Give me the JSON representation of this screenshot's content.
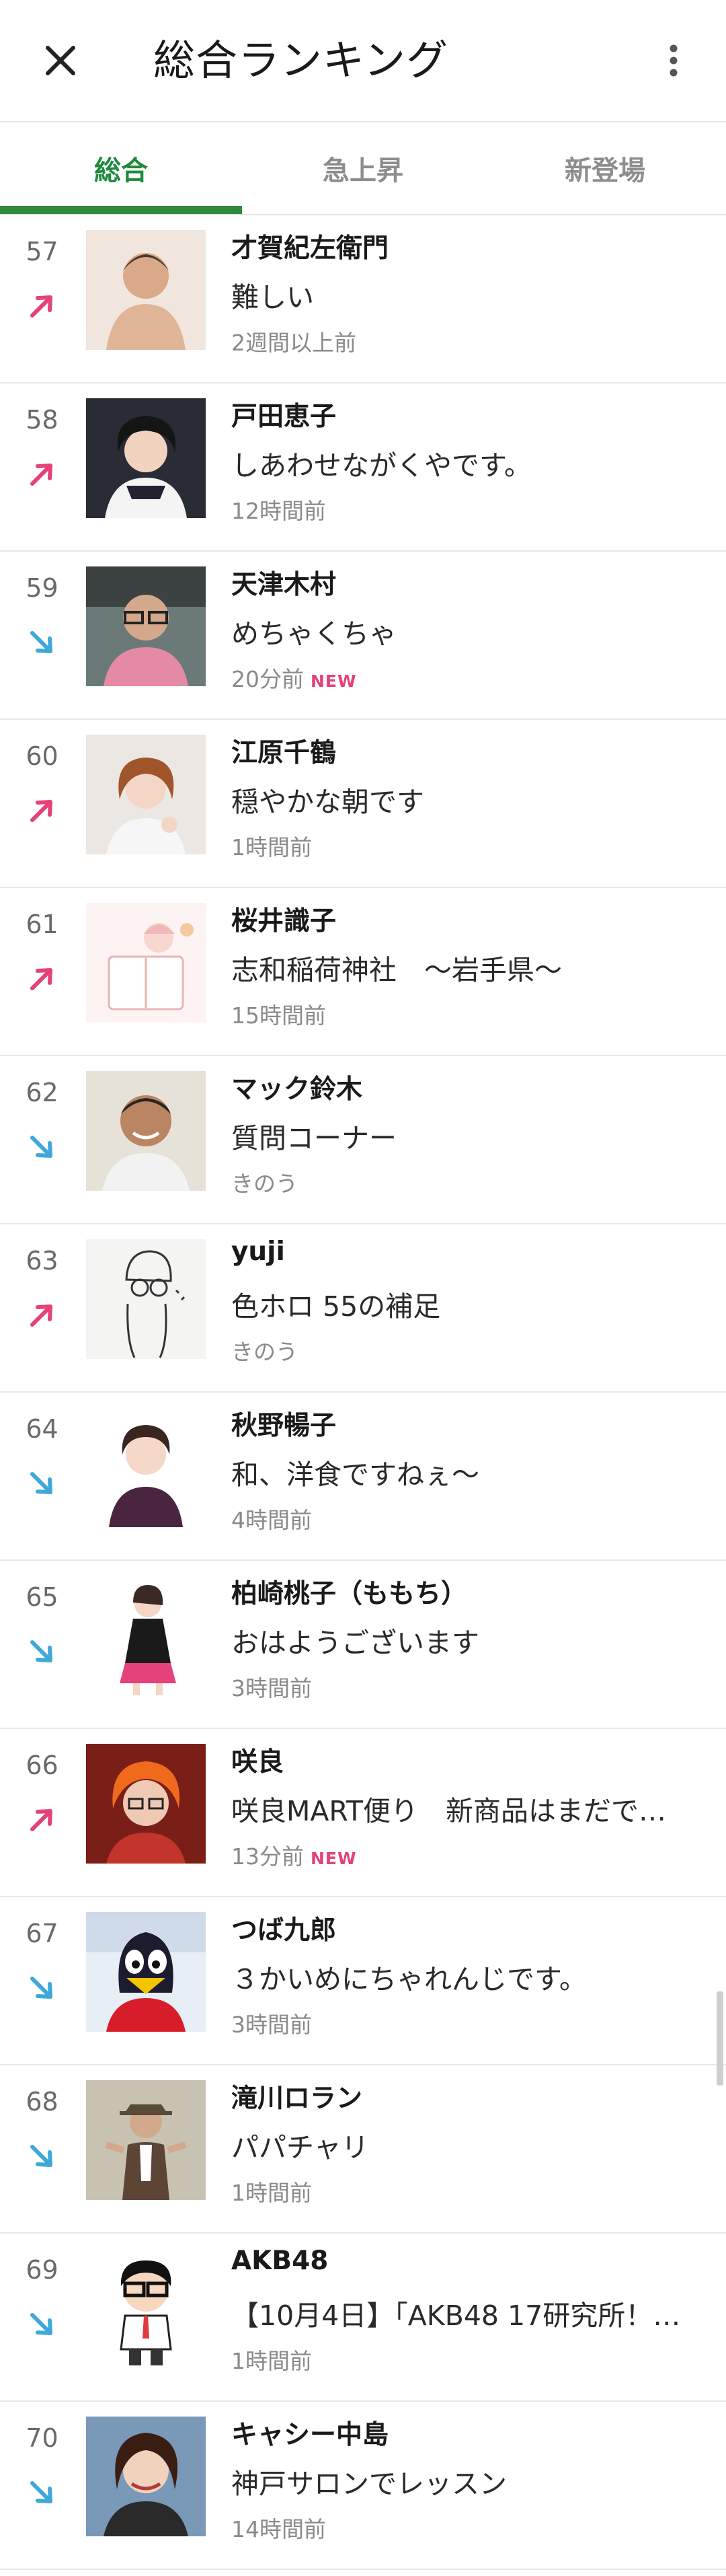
{
  "header": {
    "title": "総合ランキング"
  },
  "tabs": [
    {
      "label": "総合",
      "active": true
    },
    {
      "label": "急上昇",
      "active": false
    },
    {
      "label": "新登場",
      "active": false
    }
  ],
  "colors": {
    "accent_green": "#2e8b3e",
    "up_arrow": "#e5417a",
    "down_arrow": "#3ea9d8",
    "new_badge": "#e5417a"
  },
  "rows": [
    {
      "rank": "57",
      "trend": "up",
      "name": "才賀紀左衛門",
      "post": "難しい",
      "time": "2週間以上前",
      "new": ""
    },
    {
      "rank": "58",
      "trend": "up",
      "name": "戸田恵子",
      "post": "しあわせながくやです。",
      "time": "12時間前",
      "new": ""
    },
    {
      "rank": "59",
      "trend": "down",
      "name": "天津木村",
      "post": "めちゃくちゃ",
      "time": "20分前",
      "new": "NEW"
    },
    {
      "rank": "60",
      "trend": "up",
      "name": "江原千鶴",
      "post": "穏やかな朝です",
      "time": "1時間前",
      "new": ""
    },
    {
      "rank": "61",
      "trend": "up",
      "name": "桜井識子",
      "post": "志和稲荷神社　～岩手県～",
      "time": "15時間前",
      "new": ""
    },
    {
      "rank": "62",
      "trend": "down",
      "name": "マック鈴木",
      "post": "質問コーナー",
      "time": "きのう",
      "new": ""
    },
    {
      "rank": "63",
      "trend": "up",
      "name": "yuji",
      "post": "色ホロ 55の補足",
      "time": "きのう",
      "new": ""
    },
    {
      "rank": "64",
      "trend": "down",
      "name": "秋野暢子",
      "post": "和、洋食ですねぇ～",
      "time": "4時間前",
      "new": ""
    },
    {
      "rank": "65",
      "trend": "down",
      "name": "柏崎桃子（ももち）",
      "post": "おはようございます",
      "time": "3時間前",
      "new": ""
    },
    {
      "rank": "66",
      "trend": "up",
      "name": "咲良",
      "post": "咲良MART便り　新商品はまだで…",
      "time": "13分前",
      "new": "NEW"
    },
    {
      "rank": "67",
      "trend": "down",
      "name": "つば九郎",
      "post": "３かいめにちゃれんじです。",
      "time": "3時間前",
      "new": ""
    },
    {
      "rank": "68",
      "trend": "down",
      "name": "滝川ロラン",
      "post": "パパチャリ",
      "time": "1時間前",
      "new": ""
    },
    {
      "rank": "69",
      "trend": "down",
      "name": "AKB48",
      "post": "【10月4日】「AKB48 17研究所！…",
      "time": "1時間前",
      "new": ""
    },
    {
      "rank": "70",
      "trend": "down",
      "name": "キャシー中島",
      "post": "神戸サロンでレッスン",
      "time": "14時間前",
      "new": ""
    }
  ]
}
